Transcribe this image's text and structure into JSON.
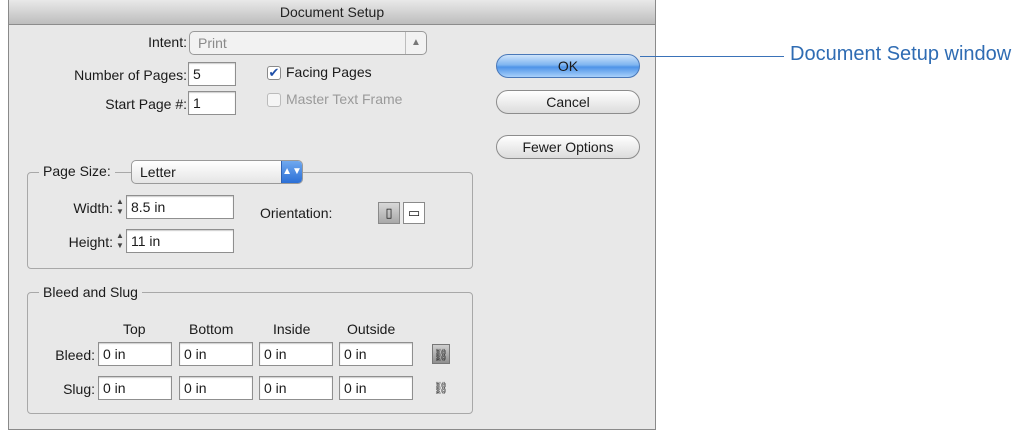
{
  "dialog": {
    "title": "Document Setup",
    "intent": {
      "label": "Intent:",
      "value": "Print"
    },
    "num_pages": {
      "label": "Number of Pages:",
      "value": "5"
    },
    "start_page": {
      "label": "Start Page #:",
      "value": "1"
    },
    "facing_pages": {
      "label": "Facing Pages",
      "checked": true
    },
    "master_text_frame": {
      "label": "Master Text Frame",
      "checked": false
    },
    "page_size": {
      "legend": "Page Size:",
      "value": "Letter",
      "width": {
        "label": "Width:",
        "value": "8.5 in"
      },
      "height": {
        "label": "Height:",
        "value": "11 in"
      },
      "orientation_label": "Orientation:"
    },
    "bleed_slug": {
      "legend": "Bleed and Slug",
      "columns": [
        "Top",
        "Bottom",
        "Inside",
        "Outside"
      ],
      "bleed": {
        "label": "Bleed:",
        "values": [
          "0 in",
          "0 in",
          "0 in",
          "0 in"
        ]
      },
      "slug": {
        "label": "Slug:",
        "values": [
          "0 in",
          "0 in",
          "0 in",
          "0 in"
        ]
      }
    },
    "buttons": {
      "ok": "OK",
      "cancel": "Cancel",
      "fewer_options": "Fewer Options"
    }
  },
  "annotation": {
    "text": "Document Setup window",
    "color": "#2f6cb3"
  },
  "icons": {
    "popup": "up-down-arrows-icon",
    "portrait": "portrait-orientation-icon",
    "landscape": "landscape-orientation-icon",
    "chain": "chain-link-icon",
    "broken_chain": "broken-chain-icon"
  }
}
